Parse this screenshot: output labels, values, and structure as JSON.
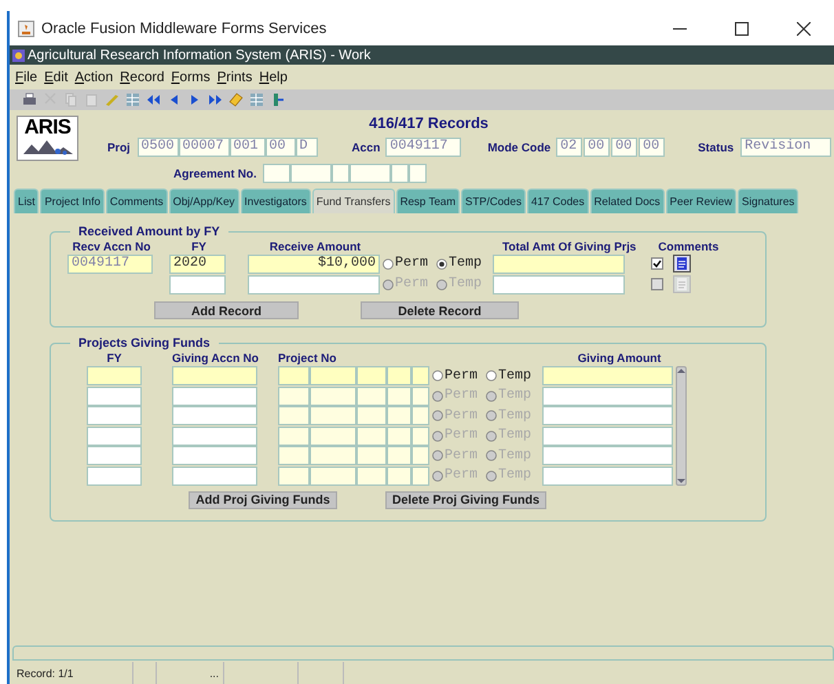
{
  "window": {
    "title": "Oracle Fusion Middleware Forms Services"
  },
  "app_title": "Agricultural Research Information System (ARIS) - Work",
  "menu": [
    "File",
    "Edit",
    "Action",
    "Record",
    "Forms",
    "Prints",
    "Help"
  ],
  "header": {
    "logo": "ARIS",
    "title": "416/417 Records",
    "proj_label": "Proj",
    "proj": [
      "0500",
      "00007",
      "001",
      "00",
      "D"
    ],
    "accn_label": "Accn",
    "accn": "0049117",
    "mode_label": "Mode Code",
    "mode": [
      "02",
      "00",
      "00",
      "00"
    ],
    "status_label": "Status",
    "status": "Revision",
    "agreement_label": "Agreement No."
  },
  "tabs": [
    {
      "label": "List",
      "selected": false
    },
    {
      "label": "Project Info",
      "selected": false
    },
    {
      "label": "Comments",
      "selected": false
    },
    {
      "label": "Obj/App/Key",
      "selected": false
    },
    {
      "label": "Investigators",
      "selected": false
    },
    {
      "label": "Fund Transfers",
      "selected": true
    },
    {
      "label": "Resp Team",
      "selected": false
    },
    {
      "label": "STP/Codes",
      "selected": false
    },
    {
      "label": "417 Codes",
      "selected": false
    },
    {
      "label": "Related Docs",
      "selected": false
    },
    {
      "label": "Peer Review",
      "selected": false
    },
    {
      "label": "Signatures",
      "selected": false
    }
  ],
  "received": {
    "title": "Received Amount by FY",
    "columns": [
      "Recv Accn No",
      "FY",
      "Receive Amount",
      "Total Amt Of Giving Prjs",
      "Comments"
    ],
    "rows": [
      {
        "recv_accn": "0049117",
        "fy": "2020",
        "amount": "$10,000",
        "current": true,
        "disabled": false,
        "comments_checked": true,
        "options": [
          {
            "label": "Perm",
            "selected": false
          },
          {
            "label": "Temp",
            "selected": true
          }
        ]
      },
      {
        "fy": "",
        "current": false,
        "disabled": true,
        "comments_checked": false,
        "options": [
          {
            "label": "Perm",
            "selected": false
          },
          {
            "label": "Temp",
            "selected": false
          }
        ]
      }
    ],
    "buttons": [
      "Add Record",
      "Delete Record"
    ]
  },
  "giving": {
    "title": "Projects Giving Funds",
    "columns": [
      "FY",
      "Giving Accn No",
      "Project No",
      "Giving Amount"
    ],
    "rows": [
      {
        "current": true,
        "disabled": false,
        "options": [
          {
            "label": "Perm",
            "selected": false
          },
          {
            "label": "Temp",
            "selected": false
          }
        ]
      },
      {
        "current": false,
        "disabled": true,
        "options": [
          {
            "label": "Perm",
            "selected": false
          },
          {
            "label": "Temp",
            "selected": false
          }
        ]
      },
      {
        "current": false,
        "disabled": true,
        "options": [
          {
            "label": "Perm",
            "selected": false
          },
          {
            "label": "Temp",
            "selected": false
          }
        ]
      },
      {
        "current": false,
        "disabled": true,
        "options": [
          {
            "label": "Perm",
            "selected": false
          },
          {
            "label": "Temp",
            "selected": false
          }
        ]
      },
      {
        "current": false,
        "disabled": true,
        "options": [
          {
            "label": "Perm",
            "selected": false
          },
          {
            "label": "Temp",
            "selected": false
          }
        ]
      },
      {
        "current": false,
        "disabled": true,
        "options": [
          {
            "label": "Perm",
            "selected": false
          },
          {
            "label": "Temp",
            "selected": false
          }
        ]
      }
    ],
    "buttons": [
      "Add Proj Giving Funds",
      "Delete Proj Giving Funds"
    ]
  },
  "status_bar": {
    "record": "Record: 1/1",
    "ellipsis": "..."
  }
}
